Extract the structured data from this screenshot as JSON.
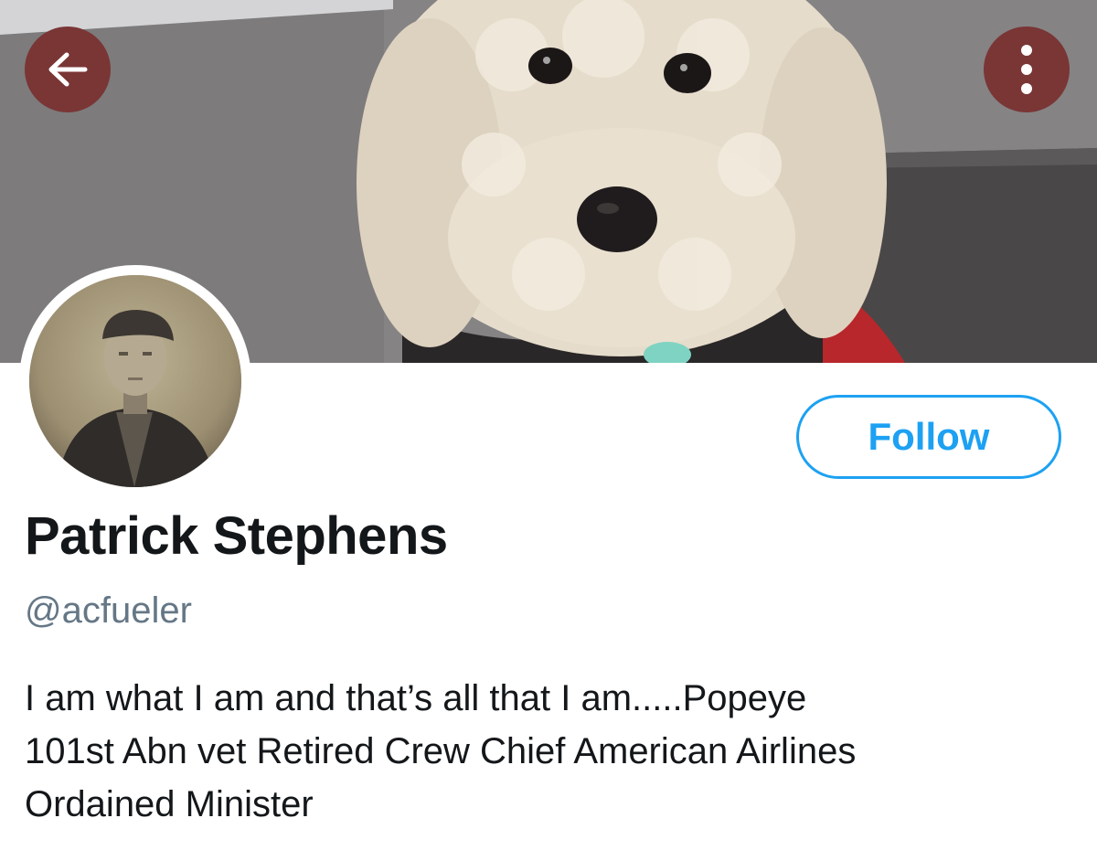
{
  "header": {
    "back_icon": "arrow-left-icon",
    "more_icon": "more-vertical-icon",
    "button_color": "#7a3535"
  },
  "profile": {
    "display_name": "Patrick Stephens",
    "handle": "@acfueler",
    "bio_lines": [
      "I am what I am and that’s all that I am.....Popeye",
      "101st Abn vet Retired Crew Chief American Airlines",
      "Ordained Minister"
    ],
    "follow_label": "Follow"
  },
  "colors": {
    "accent": "#1da1f2",
    "name_text": "#14171a",
    "handle_text": "#657786"
  }
}
